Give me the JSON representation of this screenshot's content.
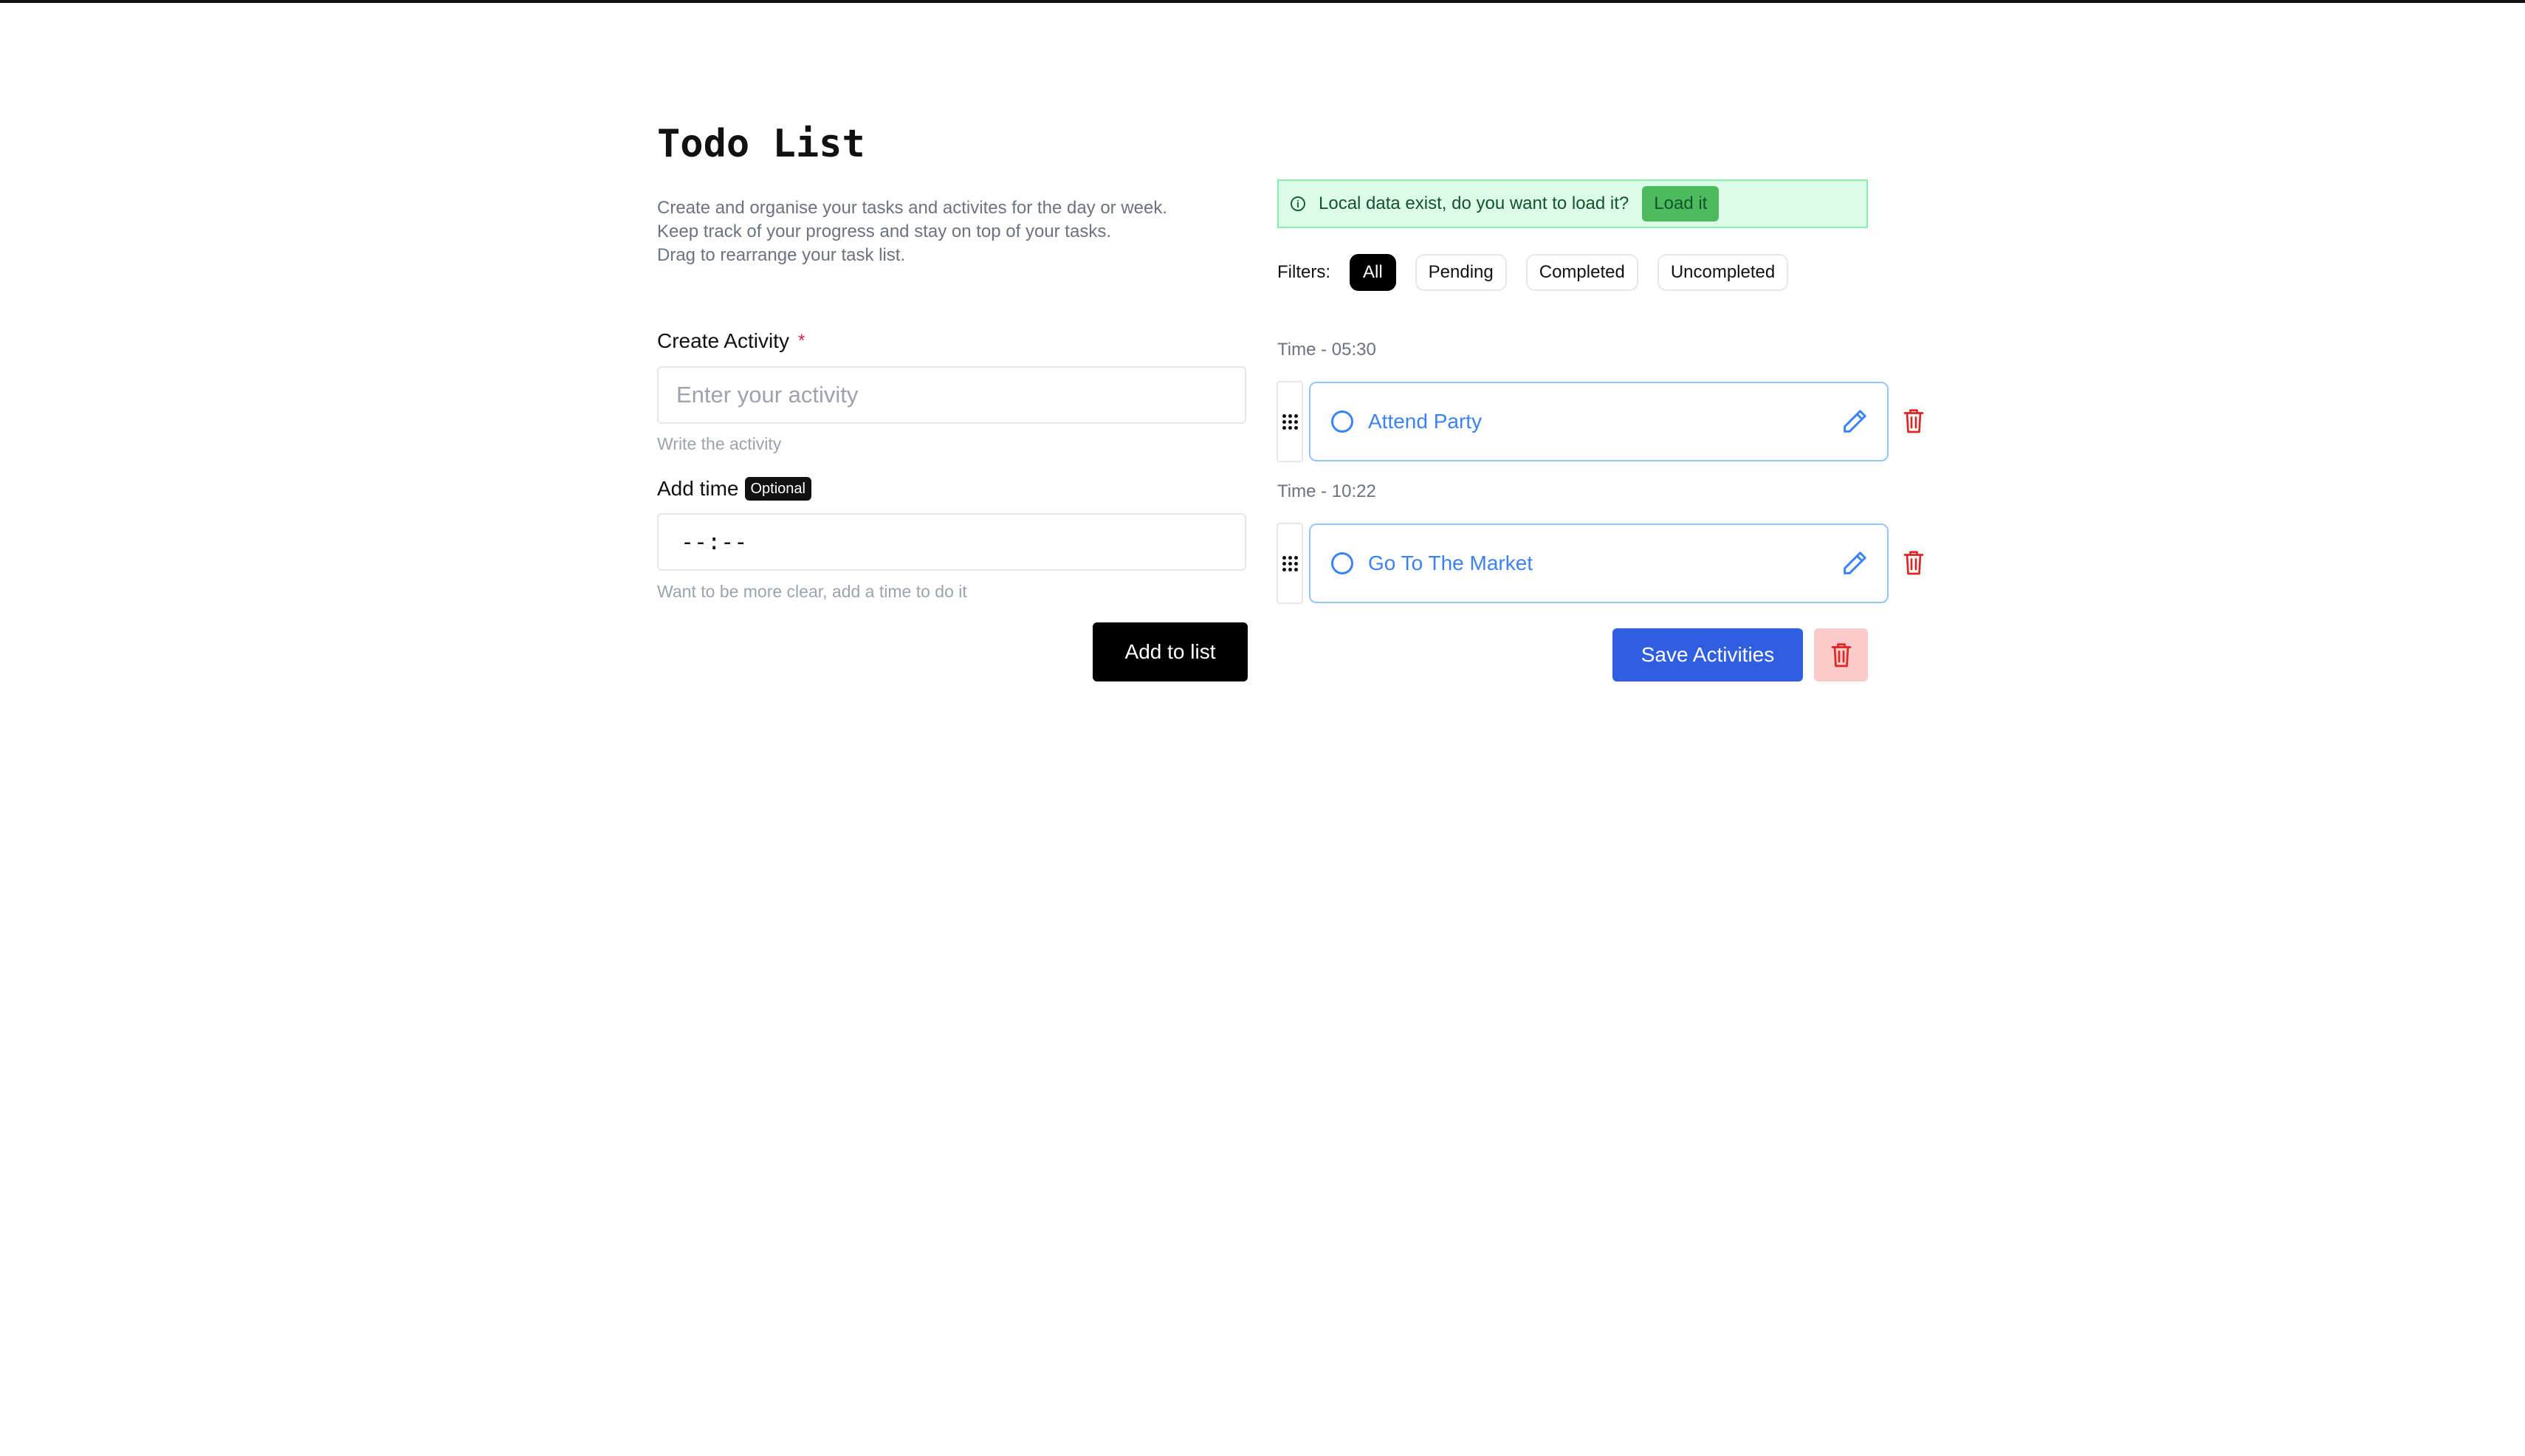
{
  "page": {
    "title": "Todo List",
    "description": [
      "Create and organise your tasks and activites for the day or week.",
      "Keep track of your progress and stay on top of your tasks.",
      "Drag to rearrange your task list."
    ]
  },
  "form": {
    "activity_label": "Create Activity",
    "required_mark": "*",
    "activity_placeholder": "Enter your activity",
    "activity_hint": "Write the activity",
    "time_label": "Add time",
    "optional_badge": "Optional",
    "time_value": "--:--",
    "time_hint": "Want to be more clear, add a time to do it",
    "add_button": "Add to list"
  },
  "alert": {
    "message": "Local data exist, do you want to load it?",
    "button": "Load it"
  },
  "filters": {
    "label": "Filters:",
    "options": [
      "All",
      "Pending",
      "Completed",
      "Uncompleted"
    ],
    "active": "All"
  },
  "tasks": [
    {
      "time_label": "Time - 05:30",
      "text": "Attend Party"
    },
    {
      "time_label": "Time - 10:22",
      "text": "Go To The Market"
    }
  ],
  "actions": {
    "save_button": "Save Activities"
  },
  "colors": {
    "accent_blue": "#2f5ee0",
    "danger_red": "#dc2626",
    "alert_green": "#dcfce7"
  }
}
